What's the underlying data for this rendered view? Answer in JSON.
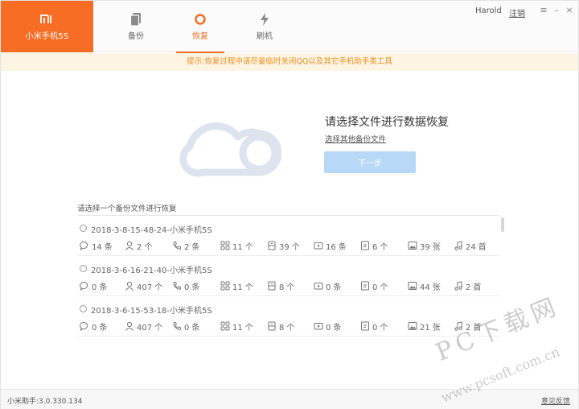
{
  "brand": {
    "name": "小米手机5S",
    "logo_text": "mi"
  },
  "tabs": [
    {
      "label": "备份",
      "icon": "copy-icon",
      "active": false
    },
    {
      "label": "恢复",
      "icon": "restore-icon",
      "active": true
    },
    {
      "label": "刷机",
      "icon": "flash-icon",
      "active": false
    }
  ],
  "user": {
    "name": "Harold",
    "register": "注销"
  },
  "window_controls": {
    "menu": "≡",
    "minimize": "–",
    "close": "×"
  },
  "notice": "提示:恢复过程中请尽量临时关闭QQ以及其它手机助手类工具",
  "hero": {
    "title": "请选择文件进行数据恢复",
    "link": "选择其他备份文件",
    "next_button": "下一步"
  },
  "list": {
    "title": "请选择一个备份文件进行恢复",
    "items": [
      {
        "name": "2018-3-8-15-48-24-小米手机5S",
        "stats": [
          {
            "icon": "message-icon",
            "value": "14",
            "unit": "条"
          },
          {
            "icon": "contact-icon",
            "value": "2",
            "unit": "个"
          },
          {
            "icon": "phone-icon",
            "value": "2",
            "unit": "条"
          },
          {
            "icon": "apps-icon",
            "value": "11",
            "unit": "个"
          },
          {
            "icon": "storage-icon",
            "value": "39",
            "unit": "个"
          },
          {
            "icon": "video-icon",
            "value": "16",
            "unit": "条"
          },
          {
            "icon": "note-icon",
            "value": "6",
            "unit": "个"
          },
          {
            "icon": "image-icon",
            "value": "39",
            "unit": "张"
          },
          {
            "icon": "music-icon",
            "value": "24",
            "unit": "首"
          }
        ]
      },
      {
        "name": "2018-3-6-16-21-40-小米手机5S",
        "stats": [
          {
            "icon": "message-icon",
            "value": "0",
            "unit": "条"
          },
          {
            "icon": "contact-icon",
            "value": "407",
            "unit": "个"
          },
          {
            "icon": "phone-icon",
            "value": "0",
            "unit": "条"
          },
          {
            "icon": "apps-icon",
            "value": "11",
            "unit": "个"
          },
          {
            "icon": "storage-icon",
            "value": "8",
            "unit": "个"
          },
          {
            "icon": "video-icon",
            "value": "0",
            "unit": "条"
          },
          {
            "icon": "note-icon",
            "value": "0",
            "unit": "个"
          },
          {
            "icon": "image-icon",
            "value": "44",
            "unit": "张"
          },
          {
            "icon": "music-icon",
            "value": "2",
            "unit": "首"
          }
        ]
      },
      {
        "name": "2018-3-6-15-53-18-小米手机5S",
        "stats": [
          {
            "icon": "message-icon",
            "value": "0",
            "unit": "条"
          },
          {
            "icon": "contact-icon",
            "value": "407",
            "unit": "个"
          },
          {
            "icon": "phone-icon",
            "value": "0",
            "unit": "条"
          },
          {
            "icon": "apps-icon",
            "value": "11",
            "unit": "个"
          },
          {
            "icon": "storage-icon",
            "value": "8",
            "unit": "个"
          },
          {
            "icon": "video-icon",
            "value": "0",
            "unit": "条"
          },
          {
            "icon": "note-icon",
            "value": "0",
            "unit": "个"
          },
          {
            "icon": "image-icon",
            "value": "21",
            "unit": "张"
          },
          {
            "icon": "music-icon",
            "value": "2",
            "unit": "首"
          }
        ]
      }
    ]
  },
  "footer": {
    "version": "小米助手:3.0.330.134",
    "feedback": "意见反馈"
  },
  "watermark": {
    "line1": "PC下载网",
    "line2": "www.pcsoft.com.cn"
  },
  "colors": {
    "accent": "#f86d24",
    "notice_bg": "#fdf4e4",
    "notice_text": "#e9901f",
    "button": "#b8d8f8"
  }
}
